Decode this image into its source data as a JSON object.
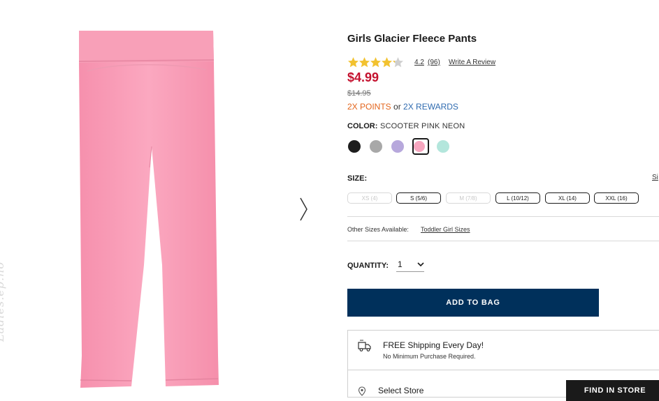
{
  "product": {
    "title": "Girls Glacier Fleece Pants",
    "rating": "4.2",
    "review_count": "(96)",
    "stars_filled": 4.2,
    "stars_total": 5,
    "write_review": "Write A Review",
    "price": "$4.99",
    "original_price": "$14.95",
    "rewards": {
      "points": "2X POINTS",
      "or": " or ",
      "rewards": "2X REWARDS"
    }
  },
  "color": {
    "label": "COLOR:",
    "value": "SCOOTER PINK NEON",
    "swatches": [
      {
        "name": "black",
        "hex": "#1d1d1d"
      },
      {
        "name": "gray",
        "hex": "#a8a8a8"
      },
      {
        "name": "lavender",
        "hex": "#b7a8dc"
      },
      {
        "name": "pink",
        "hex": "#f7a6bf",
        "selected": true
      },
      {
        "name": "mint",
        "hex": "#b3e6dc"
      }
    ]
  },
  "size": {
    "label": "SIZE:",
    "chart_link": "Si",
    "options": [
      {
        "label": "XS (4)",
        "available": false
      },
      {
        "label": "S (5/6)",
        "available": true
      },
      {
        "label": "M (7/8)",
        "available": false
      },
      {
        "label": "L (10/12)",
        "available": true
      },
      {
        "label": "XL (14)",
        "available": true
      },
      {
        "label": "XXL (16)",
        "available": true
      }
    ],
    "other_sizes_label": "Other Sizes Available:",
    "other_sizes_link": "Toddler Girl Sizes"
  },
  "quantity": {
    "label": "QUANTITY:",
    "value": "1"
  },
  "add_to_bag": "ADD TO BAG",
  "shipping": {
    "title": "FREE Shipping Every Day!",
    "subtitle": "No Minimum Purchase Required."
  },
  "store": {
    "select_label": "Select Store",
    "find_button": "FIND IN STORE"
  },
  "watermark": "Ladies.ep.no",
  "colors": {
    "price_red": "#c4122f",
    "points_orange": "#e3641b",
    "rewards_blue": "#2f6bb0",
    "button_navy": "#00305b",
    "star_gold": "#f2c230"
  },
  "icons": [
    "star-icon",
    "chevron-right-icon",
    "chevron-down-icon",
    "truck-icon",
    "map-pin-icon"
  ]
}
